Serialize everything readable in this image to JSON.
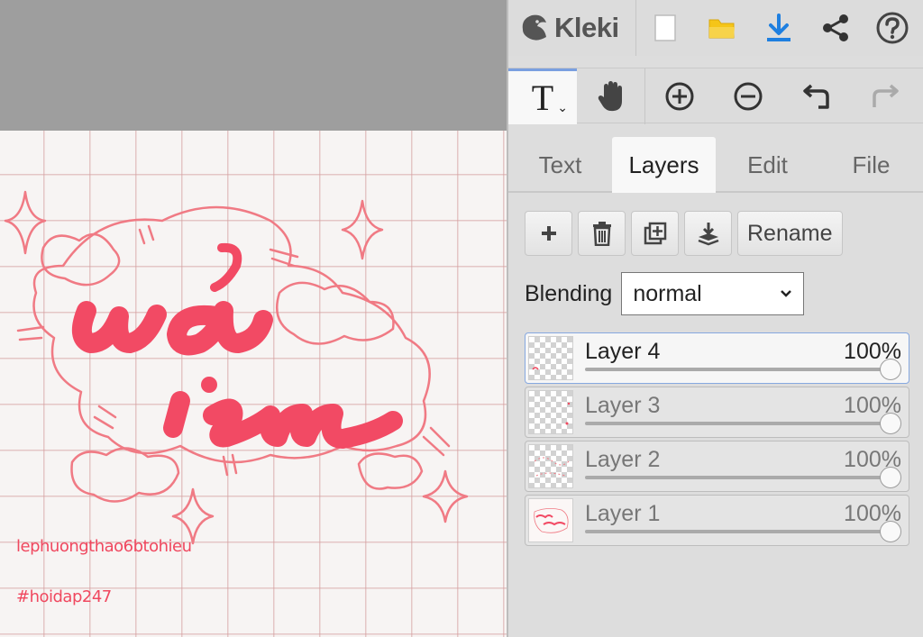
{
  "canvas": {
    "credits": [
      "lephuongthao6btohieu",
      "#hoidap247"
    ]
  },
  "topbar": {
    "logo_text": "Kleki"
  },
  "toolbar": {
    "tool_text_glyph": "T",
    "tool_chevron": "⌄"
  },
  "tabs": [
    {
      "label": "Text",
      "active": false
    },
    {
      "label": "Layers",
      "active": true
    },
    {
      "label": "Edit",
      "active": false
    },
    {
      "label": "File",
      "active": false
    }
  ],
  "layer_actions": {
    "rename_label": "Rename"
  },
  "blending": {
    "label": "Blending",
    "value": "normal"
  },
  "layers": [
    {
      "name": "Layer 4",
      "opacity": "100%",
      "active": true
    },
    {
      "name": "Layer 3",
      "opacity": "100%",
      "active": false
    },
    {
      "name": "Layer 2",
      "opacity": "100%",
      "active": false
    },
    {
      "name": "Layer 1",
      "opacity": "100%",
      "active": false
    }
  ],
  "colors": {
    "accent_blue": "#1e7fe0",
    "folder_yellow": "#f5c518",
    "art_red": "#f0485f"
  }
}
